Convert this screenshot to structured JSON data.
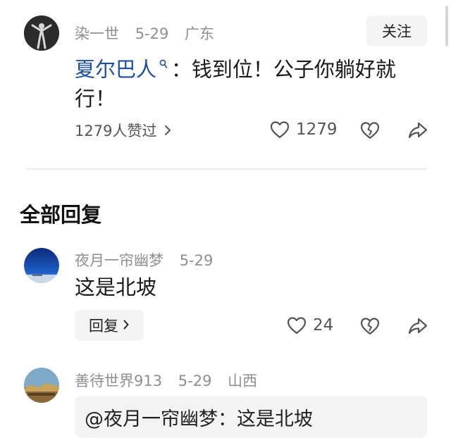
{
  "main_comment": {
    "username": "染一世",
    "date": "5-29",
    "location": "广东",
    "follow_label": "关注",
    "mention": "夏尔巴人",
    "text_line1": "：钱到位！公子你躺好就",
    "text_line2": "行！",
    "likes_summary": "1279人赞过",
    "like_count": "1279",
    "icons": [
      "chevron-right-icon",
      "heart-icon",
      "broken-heart-icon",
      "share-icon",
      "search-icon"
    ]
  },
  "section": {
    "title": "全部回复"
  },
  "replies": [
    {
      "username": "夜月一帘幽梦",
      "date": "5-29",
      "text": "这是北坡",
      "reply_label": "回复",
      "like_count": "24"
    },
    {
      "username": "善待世界913",
      "date": "5-29",
      "location": "山西",
      "quote": "@夜月一帘幽梦：这是北坡"
    }
  ],
  "colors": {
    "mention": "#1c4fa3",
    "meta": "#8f8f8f",
    "button_bg": "#f3f3f3"
  }
}
